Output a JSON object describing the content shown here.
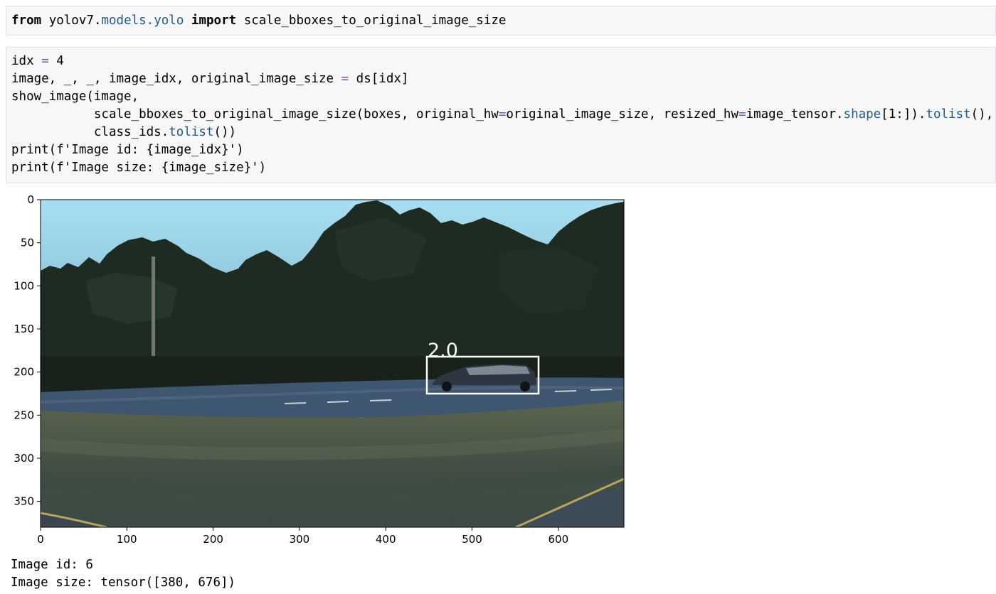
{
  "cells": {
    "import_cell": {
      "kw_from": "from",
      "module_a": "yolov7.",
      "module_b": "models.yolo",
      "kw_import": "import",
      "name": "scale_bboxes_to_original_image_size"
    },
    "code_cell": {
      "l1_a": "idx ",
      "l1_eq": "=",
      "l1_b": " 4",
      "l2_a": "image, _, _, image_idx, original_image_size ",
      "l2_eq": "=",
      "l2_b": " ds[idx]",
      "l3": "show_image(image,",
      "l4_a": "           scale_bboxes_to_original_image_size(boxes, original_hw",
      "l4_eq1": "=",
      "l4_b": "original_image_size, resized_hw",
      "l4_eq2": "=",
      "l4_c": "image_tensor.",
      "l4_d": "shape",
      "l4_e": "[1:]).",
      "l4_f": "tolist",
      "l4_g": "(),",
      "l5_a": "           class_ids.",
      "l5_b": "tolist",
      "l5_c": "())",
      "l6": "print(f'Image id: {image_idx}')",
      "l7": "print(f'Image size: {image_size}')"
    }
  },
  "output": {
    "plot": {
      "y_ticks": [
        "0",
        "50",
        "100",
        "150",
        "200",
        "250",
        "300",
        "350"
      ],
      "x_ticks": [
        "0",
        "100",
        "200",
        "300",
        "400",
        "500",
        "600"
      ],
      "bbox_label": "2.0"
    },
    "line1": "Image id: 6",
    "line2": "Image size: tensor([380, 676])"
  },
  "colors": {
    "cell_bg": "#f7f7f7",
    "cell_border": "#dde3ea",
    "operator": "#7a4fa0",
    "attribute": "#1f5a8a",
    "sky": "#9fd4ea",
    "trees": "#1c2a22",
    "road": "#3e5572",
    "grass": "#4d5a48"
  }
}
